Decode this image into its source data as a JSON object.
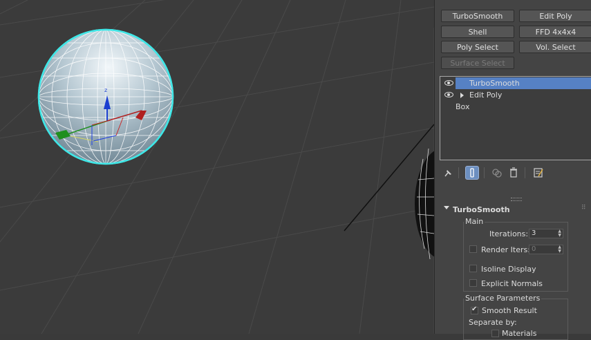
{
  "modifier_buttons": [
    {
      "label": "TurboSmooth"
    },
    {
      "label": "Edit Poly"
    },
    {
      "label": "Shell"
    },
    {
      "label": "FFD 4x4x4"
    },
    {
      "label": "Poly Select"
    },
    {
      "label": "Vol. Select"
    },
    {
      "label": "Surface Select"
    }
  ],
  "stack": {
    "items": [
      {
        "label": "TurboSmooth",
        "selected": true
      },
      {
        "label": "Edit Poly",
        "selected": false
      },
      {
        "label": "Box",
        "selected": false
      }
    ]
  },
  "toolbar": {
    "pin_icon": "pin-icon",
    "show_end_icon": "show-end-result-icon",
    "unique_icon": "make-unique-icon",
    "remove_icon": "remove-modifier-icon",
    "configure_icon": "configure-modifier-sets-icon"
  },
  "rollout": {
    "title": "TurboSmooth",
    "main": {
      "title": "Main",
      "iterations_label": "Iterations:",
      "iterations_value": "3",
      "render_iters_label": "Render Iters:",
      "render_iters_value": "0",
      "isoline_label": "Isoline Display",
      "explicit_normals_label": "Explicit Normals"
    },
    "surface": {
      "title": "Surface Parameters",
      "smooth_result_label": "Smooth Result",
      "separate_by_label": "Separate by:",
      "materials_label": "Materials"
    }
  },
  "colors": {
    "selection": "#5681c4",
    "sphere_highlight": "#3fe6e6",
    "viewport_bg": "#3b3b3b"
  }
}
